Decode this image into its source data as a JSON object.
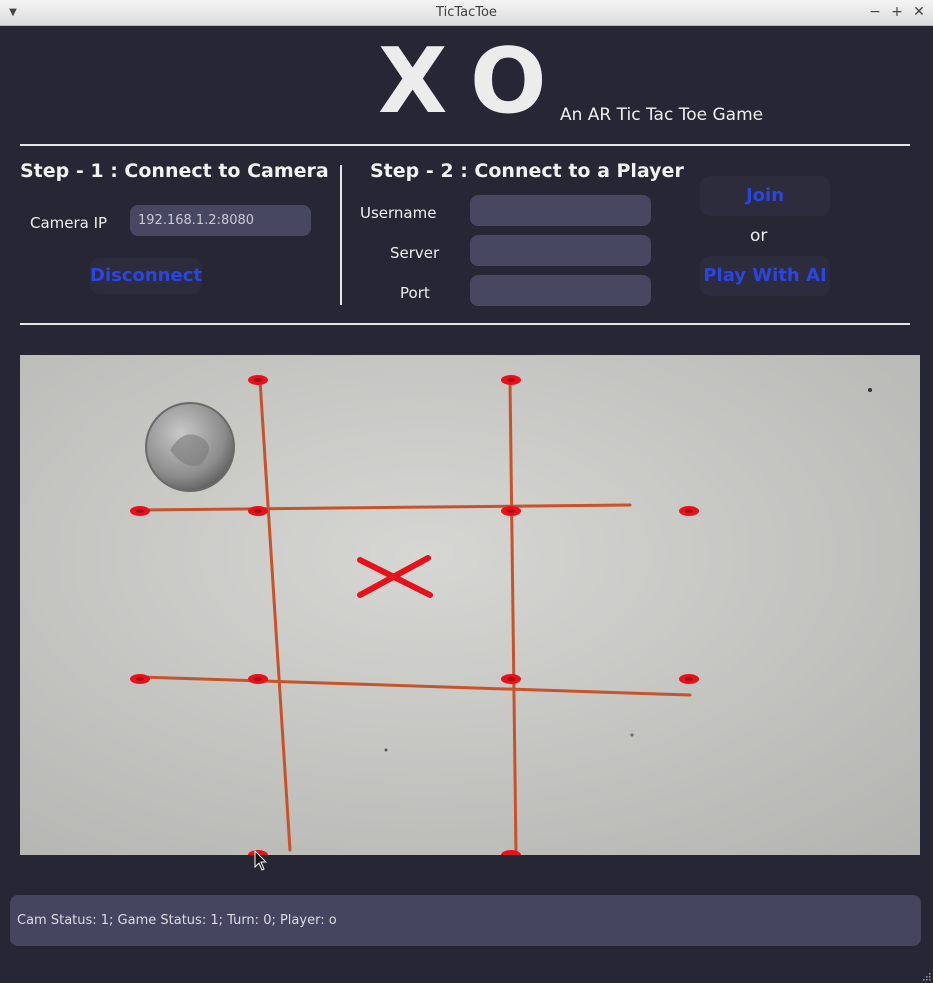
{
  "window": {
    "title": "TicTacToe"
  },
  "logo": {
    "x_letter": "X",
    "o_letter": "O"
  },
  "subtitle": "An AR Tic Tac Toe Game",
  "step1": {
    "title": "Step - 1 : Connect to Camera",
    "camera_ip_label": "Camera IP",
    "camera_ip_value": "192.168.1.2:8080",
    "disconnect_label": "Disconnect"
  },
  "step2": {
    "title": "Step - 2 : Connect to a Player",
    "username_label": "Username",
    "username_value": "",
    "server_label": "Server",
    "server_value": "",
    "port_label": "Port",
    "port_value": "",
    "join_label": "Join",
    "or_label": "or",
    "play_ai_label": "Play With AI"
  },
  "status": {
    "text": "Cam Status: 1;  Game Status: 1;  Turn: 0;  Player: o"
  },
  "colors": {
    "background": "#262634",
    "accent_blue": "#2b45e0",
    "input_bg": "#474762",
    "marker_red": "#e8101a",
    "line_orange": "#c8522a"
  },
  "icons": {
    "window_menu": "chevron-down-icon",
    "minimize": "minimize-icon",
    "maximize": "maximize-icon",
    "close": "close-icon"
  }
}
